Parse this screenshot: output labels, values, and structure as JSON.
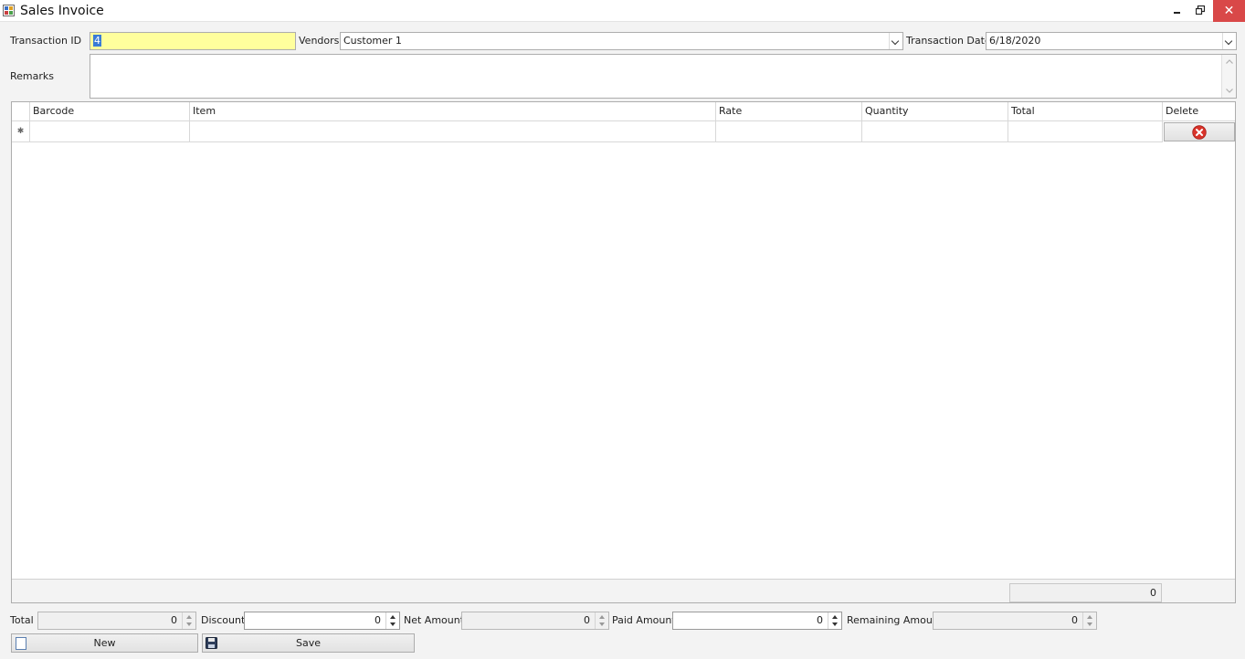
{
  "window": {
    "title": "Sales Invoice",
    "close_glyph": "✕",
    "icons": {
      "app": "app-form-icon",
      "minimize": "minimize-icon",
      "restore": "restore-icon",
      "close": "close-icon"
    }
  },
  "form": {
    "transaction_id": {
      "label": "Transaction ID",
      "value": "4"
    },
    "vendors": {
      "label": "Vendors",
      "value": "Customer 1"
    },
    "transaction_date": {
      "label": "Transaction Date",
      "value": "6/18/2020"
    },
    "remarks": {
      "label": "Remarks",
      "value": ""
    }
  },
  "grid": {
    "columns": [
      "Barcode",
      "Item",
      "Rate",
      "Quantity",
      "Total",
      "Delete"
    ],
    "new_row_marker": "✱",
    "footer_total": "0"
  },
  "totals": {
    "total": {
      "label": "Total",
      "value": "0"
    },
    "discount": {
      "label": "Discount",
      "value": "0"
    },
    "net_amount": {
      "label": "Net Amount",
      "value": "0"
    },
    "paid_amount": {
      "label": "Paid Amount",
      "value": "0"
    },
    "remaining_amount": {
      "label": "Remaining Amount",
      "value": "0"
    }
  },
  "buttons": {
    "new": "New",
    "save": "Save"
  },
  "colors": {
    "highlight_field": "#ffff9d",
    "close_button": "#d94848",
    "delete_icon": "#d9342b"
  }
}
